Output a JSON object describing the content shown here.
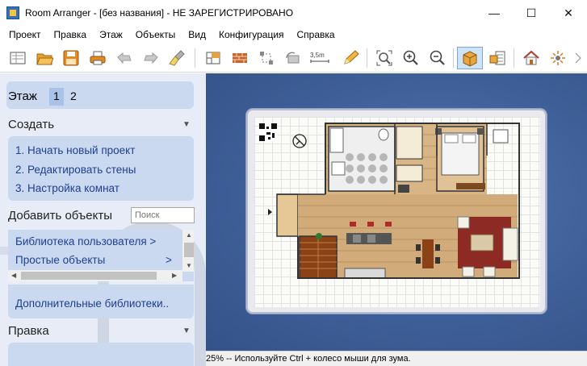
{
  "window": {
    "title": "Room Arranger - [без названия] - НЕ ЗАРЕГИСТРИРОВАНО",
    "controls": {
      "minimize": "—",
      "maximize": "☐",
      "close": "✕"
    }
  },
  "menu": [
    "Проект",
    "Правка",
    "Этаж",
    "Объекты",
    "Вид",
    "Конфигурация",
    "Справка"
  ],
  "toolbar": {
    "icons": [
      "new-project-icon",
      "open-icon",
      "save-icon",
      "print-icon",
      "undo-icon",
      "redo-icon",
      "clear-icon",
      "floor-settings-icon",
      "wall-icon",
      "resize-icon",
      "rotate-icon",
      "measure-icon",
      "draw-icon",
      "zoom-fit-icon",
      "zoom-in-icon",
      "zoom-out-icon",
      "3d-view-icon",
      "object-list-icon",
      "house-icon",
      "effects-icon"
    ],
    "measure_label": "3,5m",
    "active": "3d-view-icon"
  },
  "sidebar": {
    "floor_label": "Этаж",
    "floors": [
      "1",
      "2"
    ],
    "selected_floor": "1",
    "create_title": "Создать",
    "create_links": [
      "1. Начать новый проект",
      "2. Редактировать стены",
      "3. Настройка комнат"
    ],
    "add_title": "Добавить объекты",
    "search_placeholder": "Поиск",
    "library_items": [
      "Библиотека пользователя >",
      "Простые объекты",
      "Д"
    ],
    "library_item_arrows": [
      "",
      ">",
      ""
    ],
    "more_libraries": "Дополнительные библиотеки..",
    "edit_title": "Правка"
  },
  "status": {
    "text": "25% -- Используйте Ctrl + колесо мыши для зума."
  },
  "colors": {
    "panel": "#cbd9f0",
    "canvas_bg": "#3f5f98",
    "link": "#1d3f8f"
  }
}
